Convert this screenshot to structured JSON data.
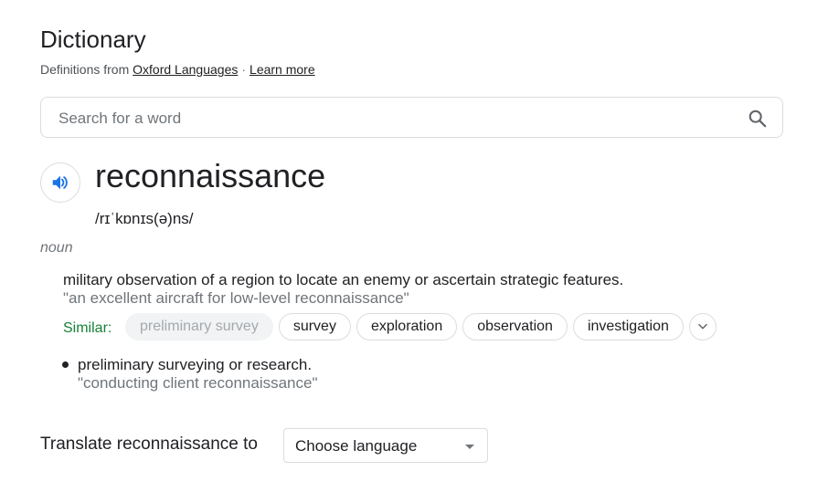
{
  "header": {
    "title": "Dictionary",
    "source_prefix": "Definitions from",
    "source_link": "Oxford Languages",
    "separator": "·",
    "learn_more": "Learn more"
  },
  "search": {
    "placeholder": "Search for a word",
    "value": ""
  },
  "entry": {
    "word": "reconnaissance",
    "phonetic": "/rɪˈkɒnɪs(ə)ns/",
    "part_of_speech": "noun",
    "senses": [
      {
        "definition": "military observation of a region to locate an enemy or ascertain strategic features.",
        "example": "\"an excellent aircraft for low-level reconnaissance\""
      },
      {
        "definition": "preliminary surveying or research.",
        "example": "\"conducting client reconnaissance\""
      }
    ],
    "similar_label": "Similar:",
    "similar": [
      "preliminary survey",
      "survey",
      "exploration",
      "observation",
      "investigation"
    ]
  },
  "translate": {
    "label": "Translate reconnaissance to",
    "select_value": "Choose language"
  },
  "colors": {
    "accent_blue": "#1a73e8",
    "similar_green": "#188038",
    "muted_text": "#70757a"
  },
  "icons": [
    "search-icon",
    "speaker-icon",
    "chevron-down-icon",
    "dropdown-caret-icon"
  ]
}
